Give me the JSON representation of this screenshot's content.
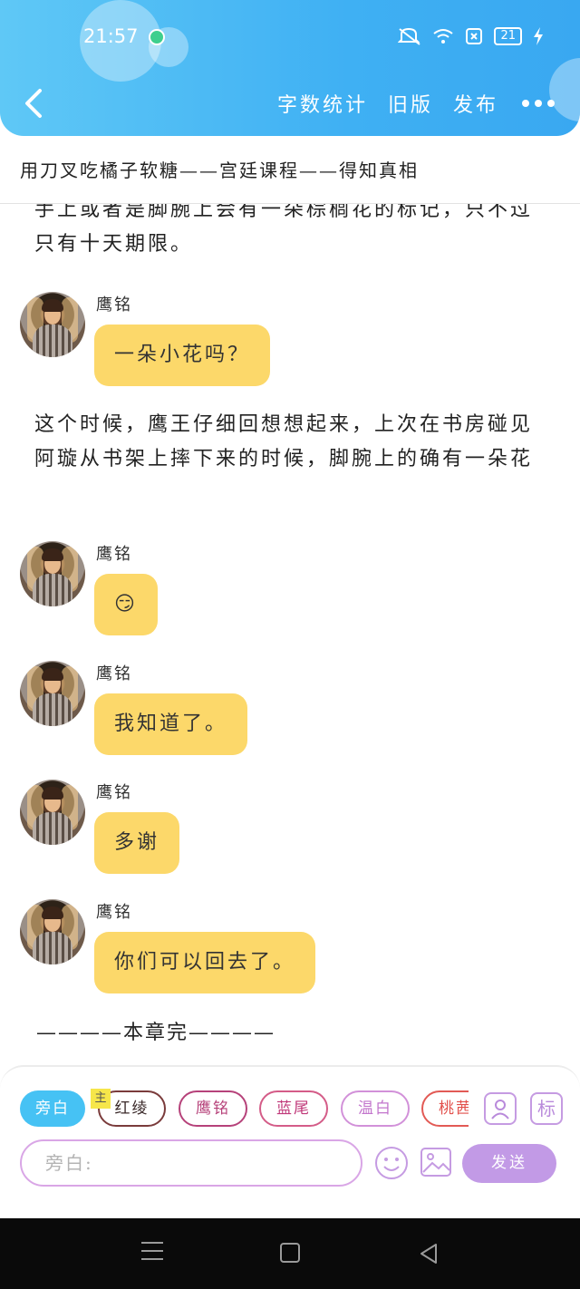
{
  "status_bar": {
    "time": "21:57",
    "battery": "21"
  },
  "header": {
    "nav_word_count": "字数统计",
    "nav_old_version": "旧版",
    "nav_publish": "发布"
  },
  "chapter_title": "用刀叉吃橘子软糖——宫廷课程——得知真相",
  "content": {
    "narration_top": "手上或者是脚腕上会有一朵棕榈花的标记，只不过只有十天期限。",
    "narration_middle": "这个时候，鹰王仔细回想想起来，上次在书房碰见阿璇从书架上摔下来的时候，脚腕上的确有一朵花",
    "messages": [
      {
        "speaker": "鹰铭",
        "text": "一朵小花吗？"
      },
      {
        "speaker": "鹰铭",
        "text": "😏"
      },
      {
        "speaker": "鹰铭",
        "text": "我知道了。"
      },
      {
        "speaker": "鹰铭",
        "text": "多谢"
      },
      {
        "speaker": "鹰铭",
        "text": "你们可以回去了。"
      }
    ],
    "chapter_end": "————本章完————"
  },
  "input_panel": {
    "characters": [
      "旁白",
      "红绫",
      "鹰铭",
      "蓝尾",
      "温白",
      "桃茜"
    ],
    "main_badge": "主",
    "tool_person": "人",
    "tool_mark": "标",
    "input_placeholder": "旁白:",
    "send_label": "发送"
  },
  "colors": {
    "header_blue": "#3fb0f3",
    "bubble_yellow": "#fcd86a",
    "send_purple": "#c29ae6",
    "narrator_chip": "#46c2f4"
  }
}
